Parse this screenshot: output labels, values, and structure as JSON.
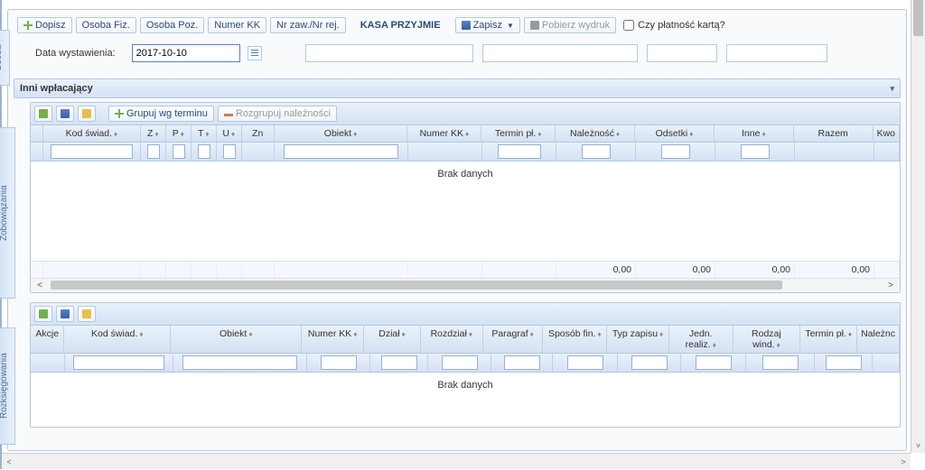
{
  "toolbar": {
    "dopisz": "Dopisz",
    "osoba_fiz": "Osoba Fiz.",
    "osoba_poz": "Osoba Poz.",
    "numer_kk": "Numer KK",
    "nr_zaw_rej": "Nr zaw./Nr rej.",
    "title": "KASA PRZYJMIE",
    "zapisz": "Zapisz",
    "pobierz": "Pobierz wydruk",
    "platnosc_karta": "Czy płatność kartą?"
  },
  "form": {
    "date_label": "Data wystawienia:",
    "date_value": "2017-10-10"
  },
  "side_tabs": {
    "osoba": "Osoba",
    "zobowiazania": "Zobowiązania",
    "rozksiegowania": "Rozksięgowania"
  },
  "section": {
    "inni_wplacajacy": "Inni wpłacający"
  },
  "panel1": {
    "grupuj": "Grupuj wg terminu",
    "rozgrupuj": "Rozgrupuj należności",
    "cols": {
      "kod_swiad": "Kod świad.",
      "z": "Z",
      "p": "P",
      "t": "T",
      "u": "U",
      "zn": "Zn",
      "obiekt": "Obiekt",
      "numer_kk": "Numer KK",
      "termin": "Termin pł.",
      "naleznosc": "Należność",
      "odsetki": "Odsetki",
      "inne": "Inne",
      "razem": "Razem",
      "kwota": "Kwo"
    },
    "empty": "Brak danych",
    "totals": {
      "naleznosc": "0,00",
      "odsetki": "0,00",
      "inne": "0,00",
      "razem": "0,00"
    }
  },
  "panel2": {
    "cols": {
      "akcje": "Akcje",
      "kod_swiad": "Kod świad.",
      "obiekt": "Obiekt",
      "numer_kk": "Numer KK",
      "dzial": "Dział",
      "rozdzial": "Rozdział",
      "paragraf": "Paragraf",
      "sposob_fin": "Sposób fin.",
      "typ_zapisu": "Typ zapisu",
      "jedn_realiz": "Jedn. realiz.",
      "rodzaj_wind": "Rodzaj wind.",
      "termin": "Termin pł.",
      "nalezn": "Należnc"
    },
    "empty": "Brak danych"
  }
}
